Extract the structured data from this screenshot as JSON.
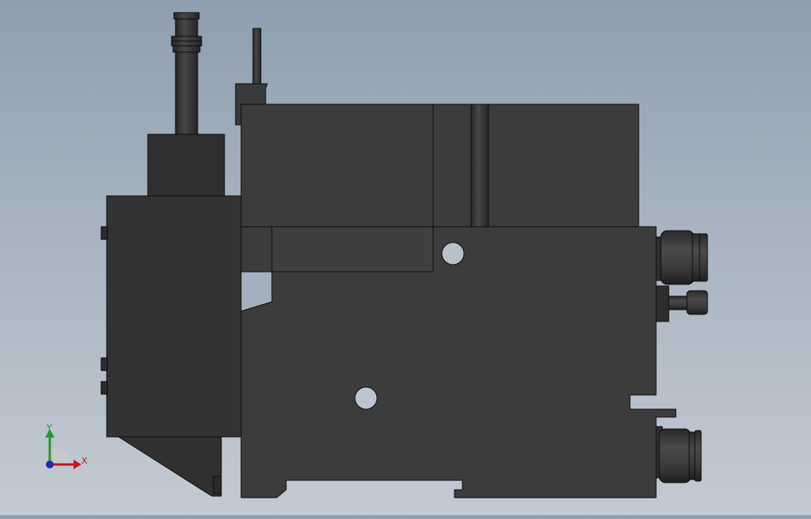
{
  "viewport": {
    "background_top": "#8f9fb0",
    "background_bottom": "#c3cad3",
    "model_color": "#3c3c3c",
    "edge_color": "#0c0c0c"
  },
  "triad": {
    "x_label": "X",
    "y_label": "Y",
    "x_color": "#c0171d",
    "y_color": "#1f9a2e",
    "z_color": "#1f2fa8"
  }
}
